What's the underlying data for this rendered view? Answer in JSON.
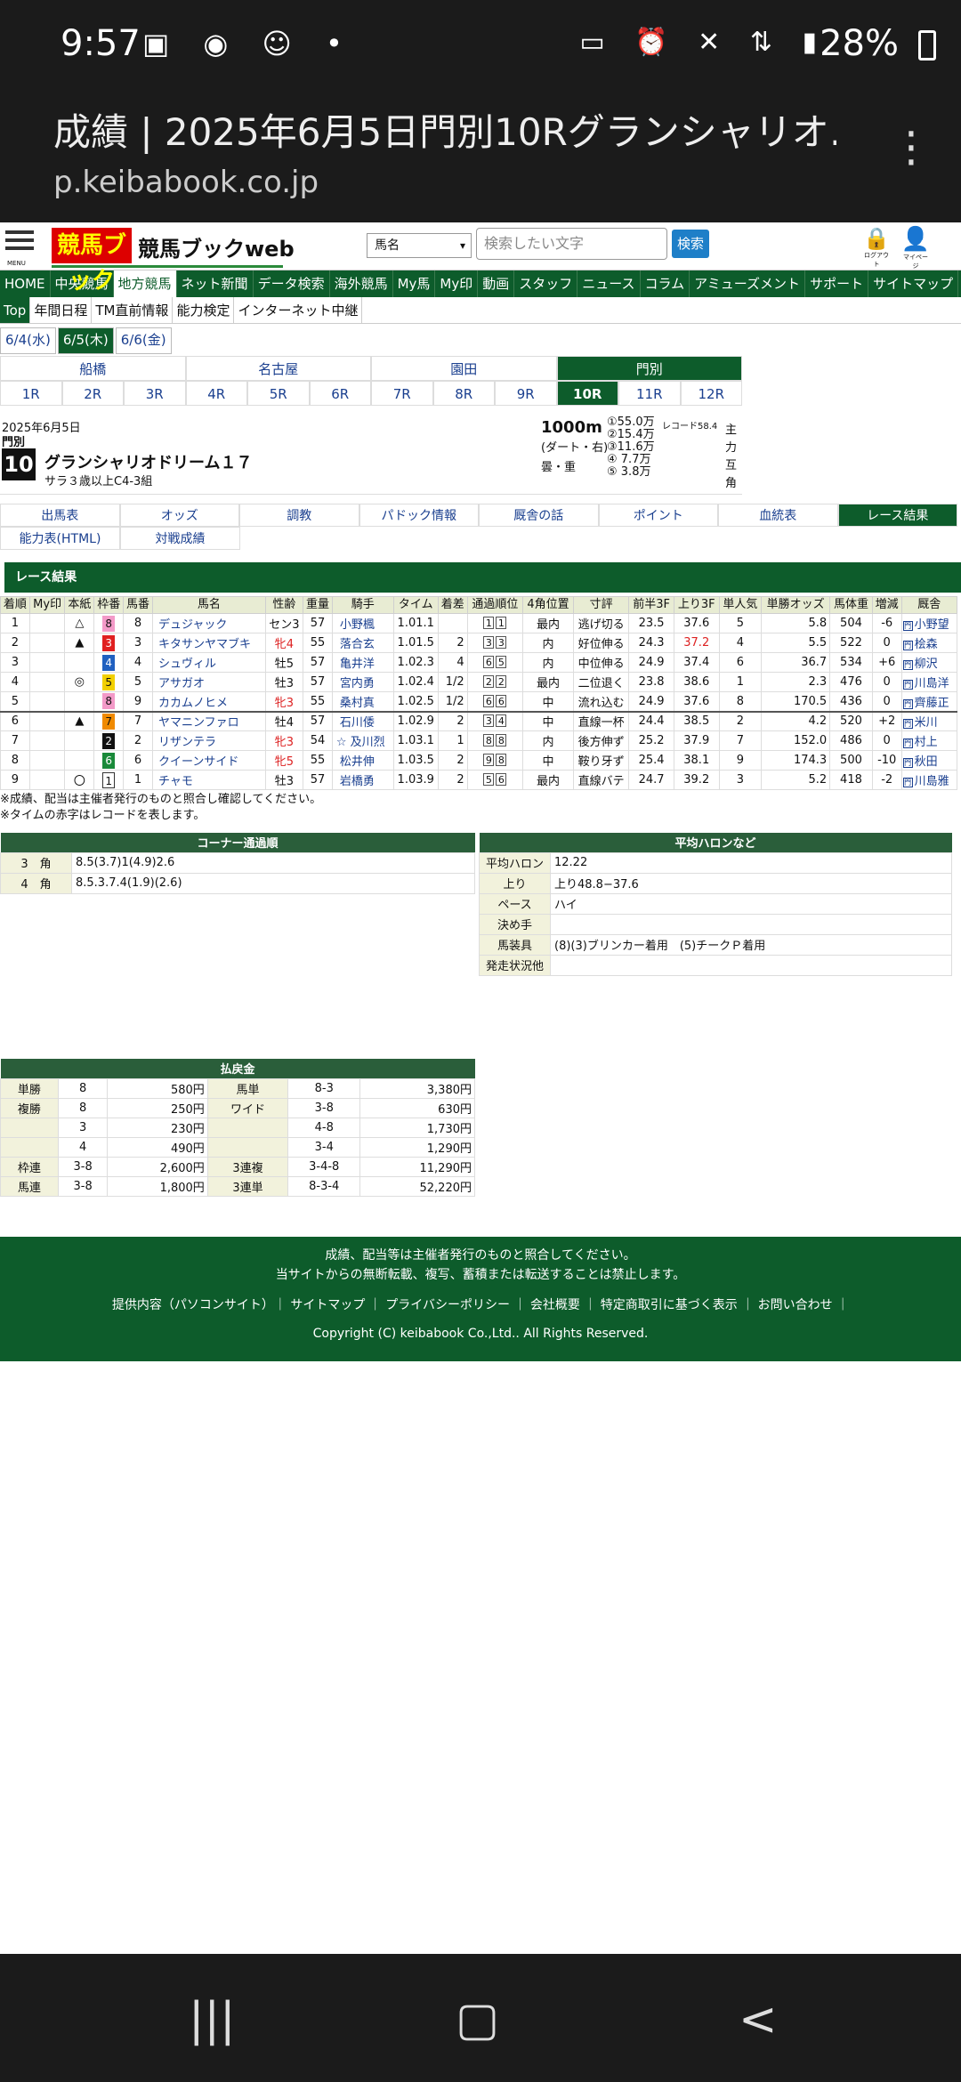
{
  "status": {
    "time": "9:57",
    "battery": "28%"
  },
  "browser": {
    "title": "成績 | 2025年6月5日門別10Rグランシャリオ…",
    "url": "p.keibabook.co.jp"
  },
  "header": {
    "logo": "競馬ブック",
    "logo_text": "競馬ブックweb",
    "select_value": "馬名",
    "search_placeholder": "検索したい文字",
    "search_button": "検索",
    "menu_label": "MENU",
    "logout_label": "ログアウト",
    "mypage_label": "マイページ"
  },
  "nav": [
    "HOME",
    "中央競馬",
    "地方競馬",
    "ネット新聞",
    "データ検索",
    "海外競馬",
    "My馬",
    "My印",
    "動画",
    "スタッフ",
    "ニュース",
    "コラム",
    "アミューズメント",
    "サポート",
    "サイトマップ"
  ],
  "subnav": [
    "Top",
    "年間日程",
    "TM直前情報",
    "能力検定",
    "インターネット中継"
  ],
  "days": [
    "6/4(水)",
    "6/5(木)",
    "6/6(金)"
  ],
  "tracks": [
    "船橋",
    "名古屋",
    "園田",
    "門別"
  ],
  "races": [
    "1R",
    "2R",
    "3R",
    "4R",
    "5R",
    "6R",
    "7R",
    "8R",
    "9R",
    "10R",
    "11R",
    "12R"
  ],
  "race": {
    "date": "2025年6月5日",
    "venue": "門別",
    "number": "10",
    "name": "グランシャリオドリーム１７",
    "class": "サラ３歳以上C4-3組",
    "distance": "1000m",
    "surface": "(ダート・右)",
    "condition": "曇・重",
    "record": "レコード58.4",
    "prizes": [
      "①55.0万",
      "②15.4万",
      "③11.6万",
      "④ 7.7万",
      "⑤ 3.8万"
    ],
    "side": "主力互角"
  },
  "tabs": [
    "出馬表",
    "オッズ",
    "調教",
    "パドック情報",
    "厩舎の話",
    "ポイント",
    "血統表",
    "レース結果"
  ],
  "tabs2": [
    "能力表(HTML)",
    "対戦成績"
  ],
  "section_title": "レース結果",
  "columns": [
    "着順",
    "My印",
    "本紙",
    "枠番",
    "馬番",
    "馬名",
    "性齢",
    "重量",
    "騎手",
    "タイム",
    "着差",
    "通過順位",
    "4角位置",
    "寸評",
    "前半3F",
    "上り3F",
    "単人気",
    "単勝オッズ",
    "馬体重",
    "増減",
    "厩舎"
  ],
  "results": [
    {
      "pos": "1",
      "my": "",
      "mark": "△",
      "waku": "8",
      "num": "8",
      "name": "デュジャック",
      "sex": "セン3",
      "wt": "57",
      "mk": "",
      "jockey": "小野楓",
      "time": "1.01.1",
      "margin": "",
      "p1": "1",
      "p2": "1",
      "corner": "最内",
      "comment": "逃げ切る",
      "f3": "23.5",
      "l3": "37.6",
      "pop": "5",
      "odds": "5.8",
      "bw": "504",
      "diff": "-6",
      "trainer": "小野望",
      "red": false,
      "redl": false
    },
    {
      "pos": "2",
      "my": "",
      "mark": "▲",
      "waku": "3",
      "num": "3",
      "name": "キタサンヤマブキ",
      "sex": "牝4",
      "wt": "55",
      "mk": "",
      "jockey": "落合玄",
      "time": "1.01.5",
      "margin": "2",
      "p1": "3",
      "p2": "3",
      "corner": "内",
      "comment": "好位伸る",
      "f3": "24.3",
      "l3": "37.2",
      "pop": "4",
      "odds": "5.5",
      "bw": "522",
      "diff": "0",
      "trainer": "桧森",
      "red": true,
      "redl": true
    },
    {
      "pos": "3",
      "my": "",
      "mark": "",
      "waku": "4",
      "num": "4",
      "name": "シュヴィル",
      "sex": "牡5",
      "wt": "57",
      "mk": "",
      "jockey": "亀井洋",
      "time": "1.02.3",
      "margin": "4",
      "p1": "6",
      "p2": "5",
      "corner": "内",
      "comment": "中位伸る",
      "f3": "24.9",
      "l3": "37.4",
      "pop": "6",
      "odds": "36.7",
      "bw": "534",
      "diff": "+6",
      "trainer": "柳沢",
      "red": false,
      "redl": false
    },
    {
      "pos": "4",
      "my": "",
      "mark": "◎",
      "waku": "5",
      "num": "5",
      "name": "アサガオ",
      "sex": "牡3",
      "wt": "57",
      "mk": "",
      "jockey": "宮内勇",
      "time": "1.02.4",
      "margin": "1/2",
      "p1": "2",
      "p2": "2",
      "corner": "最内",
      "comment": "二位退く",
      "f3": "23.8",
      "l3": "38.6",
      "pop": "1",
      "odds": "2.3",
      "bw": "476",
      "diff": "0",
      "trainer": "川島洋",
      "red": false,
      "redl": false
    },
    {
      "pos": "5",
      "my": "",
      "mark": "",
      "waku": "8",
      "num": "9",
      "name": "カカムノヒメ",
      "sex": "牝3",
      "wt": "55",
      "mk": "",
      "jockey": "桑村真",
      "time": "1.02.5",
      "margin": "1/2",
      "p1": "6",
      "p2": "6",
      "corner": "中",
      "comment": "流れ込む",
      "f3": "24.9",
      "l3": "37.6",
      "pop": "8",
      "odds": "170.5",
      "bw": "436",
      "diff": "0",
      "trainer": "齊藤正",
      "red": true,
      "redl": false
    },
    {
      "pos": "6",
      "my": "",
      "mark": "▲",
      "waku": "7",
      "num": "7",
      "name": "ヤマニンファロ",
      "sex": "牡4",
      "wt": "57",
      "mk": "",
      "jockey": "石川倭",
      "time": "1.02.9",
      "margin": "2",
      "p1": "3",
      "p2": "4",
      "corner": "中",
      "comment": "直線一杯",
      "f3": "24.4",
      "l3": "38.5",
      "pop": "2",
      "odds": "4.2",
      "bw": "520",
      "diff": "+2",
      "trainer": "米川",
      "red": false,
      "redl": false
    },
    {
      "pos": "7",
      "my": "",
      "mark": "",
      "waku": "2",
      "num": "2",
      "name": "リザンテラ",
      "sex": "牝3",
      "wt": "54",
      "mk": "☆",
      "jockey": "及川烈",
      "time": "1.03.1",
      "margin": "1",
      "p1": "8",
      "p2": "8",
      "corner": "内",
      "comment": "後方伸ず",
      "f3": "25.2",
      "l3": "37.9",
      "pop": "7",
      "odds": "152.0",
      "bw": "486",
      "diff": "0",
      "trainer": "村上",
      "red": true,
      "redl": false
    },
    {
      "pos": "8",
      "my": "",
      "mark": "",
      "waku": "6",
      "num": "6",
      "name": "クイーンサイド",
      "sex": "牝5",
      "wt": "55",
      "mk": "",
      "jockey": "松井伸",
      "time": "1.03.5",
      "margin": "2",
      "p1": "9",
      "p2": "8",
      "corner": "中",
      "comment": "鞍り牙ず",
      "f3": "25.4",
      "l3": "38.1",
      "pop": "9",
      "odds": "174.3",
      "bw": "500",
      "diff": "-10",
      "trainer": "秋田",
      "red": true,
      "redl": false
    },
    {
      "pos": "9",
      "my": "",
      "mark": "〇",
      "waku": "1",
      "num": "1",
      "name": "チャモ",
      "sex": "牡3",
      "wt": "57",
      "mk": "",
      "jockey": "岩橋勇",
      "time": "1.03.9",
      "margin": "2",
      "p1": "5",
      "p2": "6",
      "corner": "最内",
      "comment": "直線バテ",
      "f3": "24.7",
      "l3": "39.2",
      "pop": "3",
      "odds": "5.2",
      "bw": "418",
      "diff": "-2",
      "trainer": "川島雅",
      "red": false,
      "redl": false
    }
  ],
  "notes": [
    "※成績、配当は主催者発行のものと照合し確認してください。",
    "※タイムの赤字はレコードを表します。"
  ],
  "corners": {
    "title": "コーナー通過順",
    "rows": [
      {
        "k": "3　角",
        "v": "8.5(3.7)1(4.9)2.6"
      },
      {
        "k": "4　角",
        "v": "8.5.3.7.4(1.9)(2.6)"
      }
    ]
  },
  "pace": {
    "title": "平均ハロンなど",
    "rows": [
      {
        "k": "平均ハロン",
        "v": "12.22"
      },
      {
        "k": "上り",
        "v": "上り48.8−37.6"
      },
      {
        "k": "ペース",
        "v": "ハイ"
      },
      {
        "k": "決め手",
        "v": ""
      },
      {
        "k": "馬装具",
        "v": "(8)(3)ブリンカー着用　(5)チークＰ着用"
      },
      {
        "k": "発走状況他",
        "v": ""
      }
    ]
  },
  "payout": {
    "title": "払戻金",
    "rows": [
      {
        "k1": "単勝",
        "c1": "8",
        "v1": "580円",
        "k2": "馬単",
        "c2": "8-3",
        "v2": "3,380円"
      },
      {
        "k1": "複勝",
        "c1": "8",
        "v1": "250円",
        "k2": "ワイド",
        "c2": "3-8",
        "v2": "630円"
      },
      {
        "k1": "",
        "c1": "3",
        "v1": "230円",
        "k2": "",
        "c2": "4-8",
        "v2": "1,730円"
      },
      {
        "k1": "",
        "c1": "4",
        "v1": "490円",
        "k2": "",
        "c2": "3-4",
        "v2": "1,290円"
      },
      {
        "k1": "枠連",
        "c1": "3-8",
        "v1": "2,600円",
        "k2": "3連複",
        "c2": "3-4-8",
        "v2": "11,290円"
      },
      {
        "k1": "馬連",
        "c1": "3-8",
        "v1": "1,800円",
        "k2": "3連単",
        "c2": "8-3-4",
        "v2": "52,220円"
      }
    ]
  },
  "footer": {
    "line1": "成績、配当等は主催者発行のものと照合してください。",
    "line2": "当サイトからの無断転載、複写、蓄積または転送することは禁止します。",
    "links": "提供内容（パソコンサイト）｜ サイトマップ ｜ プライバシーポリシー ｜ 会社概要 ｜ 特定商取引に基づく表示 ｜ お問い合わせ ｜",
    "copyright": "Copyright (C) keibabook Co.,Ltd.. All Rights Reserved."
  }
}
